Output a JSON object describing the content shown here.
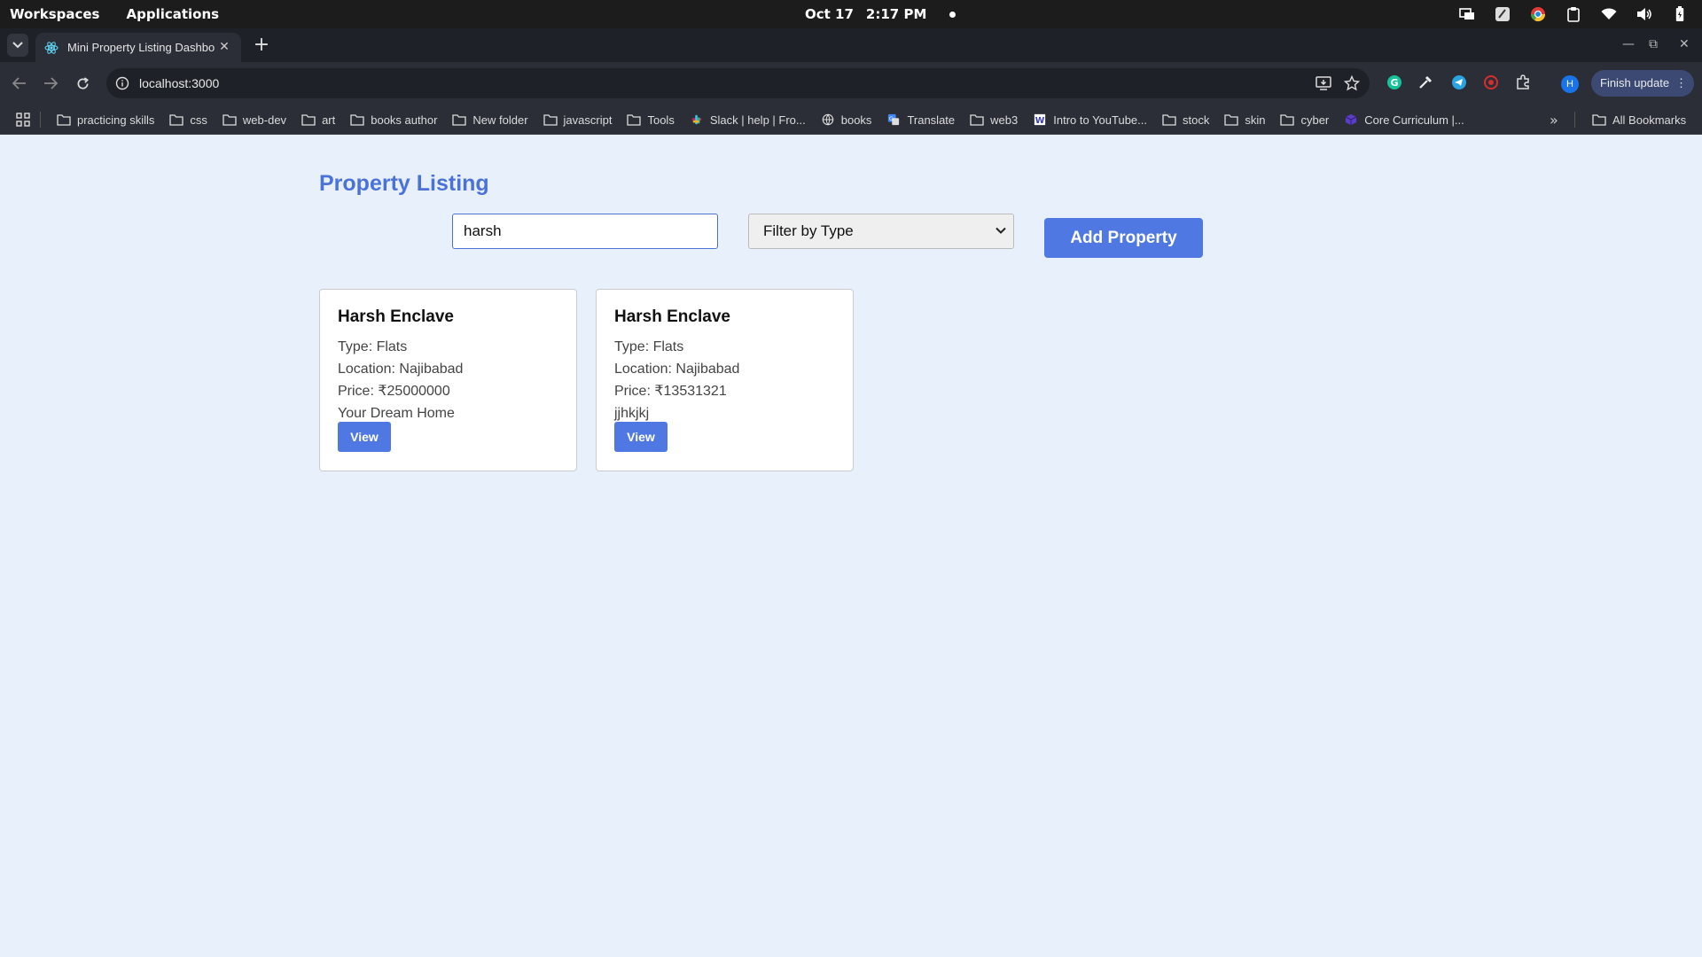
{
  "os": {
    "workspaces": "Workspaces",
    "applications": "Applications",
    "date": "Oct 17",
    "time": "2:17 PM"
  },
  "browser": {
    "tab_title": "Mini Property Listing Dashbo",
    "url": "localhost:3000",
    "finish_update": "Finish update",
    "profile_initial": "H",
    "bookmarks": [
      {
        "label": "practicing skills",
        "icon": "folder-icon"
      },
      {
        "label": "css",
        "icon": "folder-icon"
      },
      {
        "label": "web-dev",
        "icon": "folder-icon"
      },
      {
        "label": "art",
        "icon": "folder-icon"
      },
      {
        "label": "books author",
        "icon": "folder-icon"
      },
      {
        "label": "New folder",
        "icon": "folder-icon"
      },
      {
        "label": "javascript",
        "icon": "folder-icon"
      },
      {
        "label": "Tools",
        "icon": "folder-icon"
      },
      {
        "label": "Slack | help | Fro...",
        "icon": "slack-icon"
      },
      {
        "label": "books",
        "icon": "globe-icon"
      },
      {
        "label": "Translate",
        "icon": "translate-icon"
      },
      {
        "label": "web3",
        "icon": "folder-icon"
      },
      {
        "label": "Intro to YouTube...",
        "icon": "w-icon"
      },
      {
        "label": "stock",
        "icon": "folder-icon"
      },
      {
        "label": "skin",
        "icon": "folder-icon"
      },
      {
        "label": "cyber",
        "icon": "folder-icon"
      },
      {
        "label": "Core Curriculum |...",
        "icon": "cube-icon"
      }
    ],
    "all_bookmarks": "All Bookmarks"
  },
  "app": {
    "title": "Property Listing",
    "search_value": "harsh",
    "filter_selected": "Filter by Type",
    "add_button": "Add Property",
    "accent": "#4f78e2",
    "properties": [
      {
        "name": "Harsh Enclave",
        "type": "Type: Flats",
        "location": "Location: Najibabad",
        "price": "Price: ₹25000000",
        "description": "Your Dream Home",
        "view": "View"
      },
      {
        "name": "Harsh Enclave",
        "type": "Type: Flats",
        "location": "Location: Najibabad",
        "price": "Price: ₹13531321",
        "description": "jjhkjkj",
        "view": "View"
      }
    ]
  }
}
